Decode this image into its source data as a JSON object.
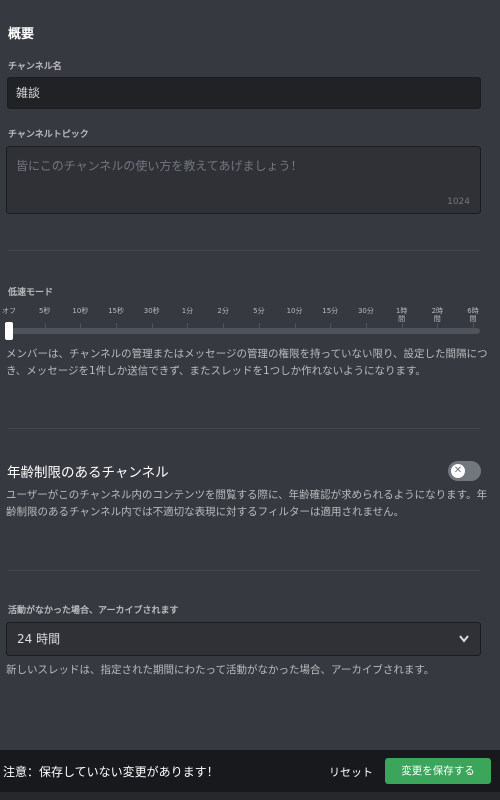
{
  "overview": {
    "title": "概要"
  },
  "channel_name": {
    "label": "チャンネル名",
    "value": "雑談"
  },
  "channel_topic": {
    "label": "チャンネルトピック",
    "placeholder": "皆にこのチャンネルの使い方を教えてあげましょう！",
    "counter": "1024"
  },
  "slowmode": {
    "label": "低速モード",
    "selected_index": 0,
    "ticks": [
      "オフ",
      "5秒",
      "10秒",
      "15秒",
      "30秒",
      "1分",
      "2分",
      "5分",
      "10分",
      "15分",
      "30分",
      "1時\n間",
      "2時\n間",
      "6時\n間"
    ],
    "help": "メンバーは、チャンネルの管理またはメッセージの管理の権限を持っていない限り、設定した間隔につき、メッセージを1件しか送信できず、またスレッドを1つしか作れないようになります。"
  },
  "age_restricted": {
    "title": "年齢制限のあるチャンネル",
    "enabled": false,
    "toggle_icon": "x-icon",
    "help": "ユーザーがこのチャンネル内のコンテンツを閲覧する際に、年齢確認が求められるようになります。年齢制限のあるチャンネル内では不適切な表現に対するフィルターは適用されません。"
  },
  "archive": {
    "label": "活動がなかった場合、アーカイブされます",
    "selected": "24 時間",
    "help": "新しいスレッドは、指定された期間にわたって活動がなかった場合、アーカイブされます。"
  },
  "unsaved_notice": {
    "message": "注意：保存していない変更があります！",
    "reset_label": "リセット",
    "save_label": "変更を保存する"
  },
  "colors": {
    "background": "#36393f",
    "input_bg": "#202225",
    "accent_green": "#3ba55c",
    "notice_bg": "#18191c"
  }
}
